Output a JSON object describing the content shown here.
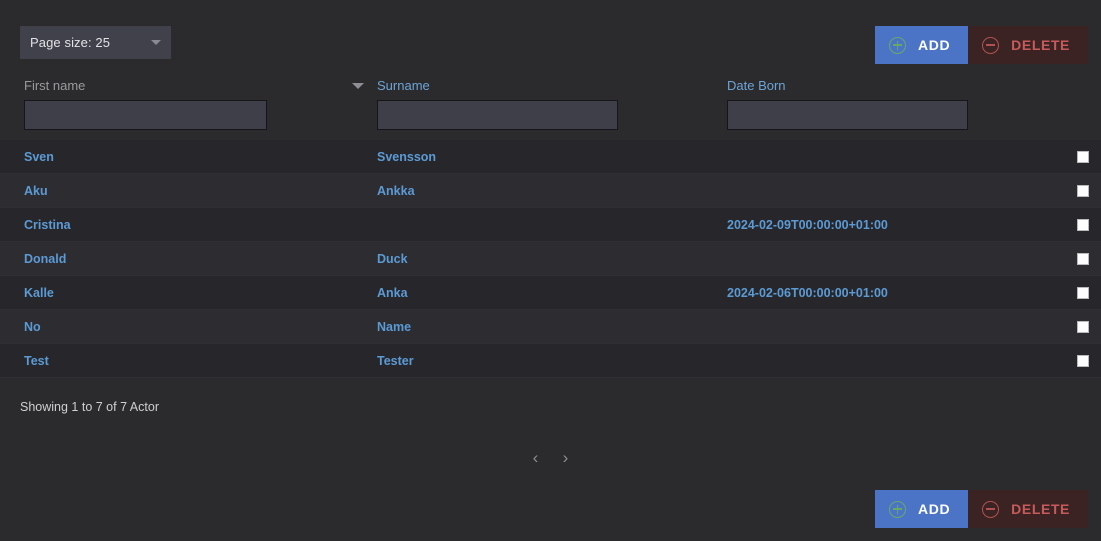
{
  "toolbar": {
    "page_size_label": "Page size: 25",
    "page_size_value": "25",
    "caret_icon": "chevron-down-icon",
    "add_label": "ADD",
    "delete_label": "DELETE",
    "add_icon": "circle-plus-icon",
    "delete_icon": "circle-minus-icon"
  },
  "colors": {
    "page_background": "#2b2b2e",
    "row_odd": "#27272b",
    "row_even": "#2c2c31",
    "cell_link": "#5c9ad4",
    "header_link": "#6da3d4",
    "header_active": "#9a9a9e",
    "add_button": "#4b74c6",
    "delete_button_bg": "#3b2323",
    "delete_button_text": "#c75b5b",
    "add_icon": "#6aa86a",
    "delete_icon": "#b05252",
    "input_background": "#3f3f4a",
    "select_background": "#41414c"
  },
  "columns": [
    {
      "key": "first_name",
      "label": "First name",
      "sorted": true,
      "sort_direction": "desc",
      "filter_value": "",
      "filter_placeholder": ""
    },
    {
      "key": "surname",
      "label": "Surname",
      "sorted": false,
      "sort_direction": "",
      "filter_value": "",
      "filter_placeholder": ""
    },
    {
      "key": "date_born",
      "label": "Date Born",
      "sorted": false,
      "sort_direction": "",
      "filter_value": "",
      "filter_placeholder": ""
    }
  ],
  "rows": [
    {
      "first_name": "Sven",
      "surname": "Svensson",
      "date_born": "",
      "selected": false
    },
    {
      "first_name": "Aku",
      "surname": "Ankka",
      "date_born": "",
      "selected": false
    },
    {
      "first_name": "Cristina",
      "surname": "",
      "date_born": "2024-02-09T00:00:00+01:00",
      "selected": false
    },
    {
      "first_name": "Donald",
      "surname": "Duck",
      "date_born": "",
      "selected": false
    },
    {
      "first_name": "Kalle",
      "surname": "Anka",
      "date_born": "2024-02-06T00:00:00+01:00",
      "selected": false
    },
    {
      "first_name": "No",
      "surname": "Name",
      "date_born": "",
      "selected": false
    },
    {
      "first_name": "Test",
      "surname": "Tester",
      "date_born": "",
      "selected": false
    }
  ],
  "footer": {
    "showing_text": "Showing 1 to 7 of 7 Actor",
    "prev_label": "‹",
    "next_label": "›",
    "prev_icon": "chevron-left-icon",
    "next_icon": "chevron-right-icon"
  }
}
